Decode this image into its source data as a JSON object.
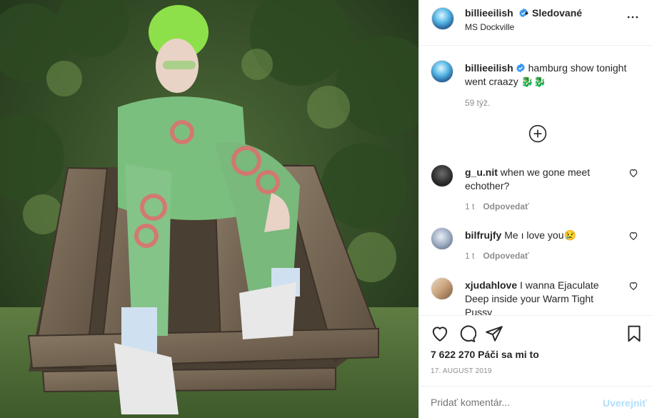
{
  "post": {
    "author": "billieeilish",
    "separator": "•",
    "follow_status": "Sledované",
    "location": "MS Dockville",
    "caption_text": "hamburg show tonight went craazy",
    "caption_emoji": "🐉🐉",
    "caption_time": "59 týž."
  },
  "comments": [
    {
      "user": "g_u.nit",
      "text": "when we gone meet echother?",
      "time": "1 t",
      "reply": "Odpovedať"
    },
    {
      "user": "bilfrujfy",
      "text": "Me ı love you😢",
      "time": "1 t",
      "reply": "Odpovedať"
    },
    {
      "user": "xjudahlove",
      "text": "I wanna Ejaculate Deep inside your Warm Tight Pussy"
    }
  ],
  "actions": {
    "likes": "7 622 270 Páči sa mi to",
    "date": "17. AUGUST 2019"
  },
  "composer": {
    "placeholder": "Pridať komentár...",
    "post_label": "Uverejniť"
  },
  "icons": [
    "verified-badge-icon",
    "more-options-icon",
    "load-more-comments-icon",
    "heart-icon",
    "comment-icon",
    "share-icon",
    "bookmark-icon"
  ],
  "colors": {
    "verified": "#3897f0",
    "muted": "#8e8e8e",
    "post_button_disabled": "#b2dffc"
  }
}
